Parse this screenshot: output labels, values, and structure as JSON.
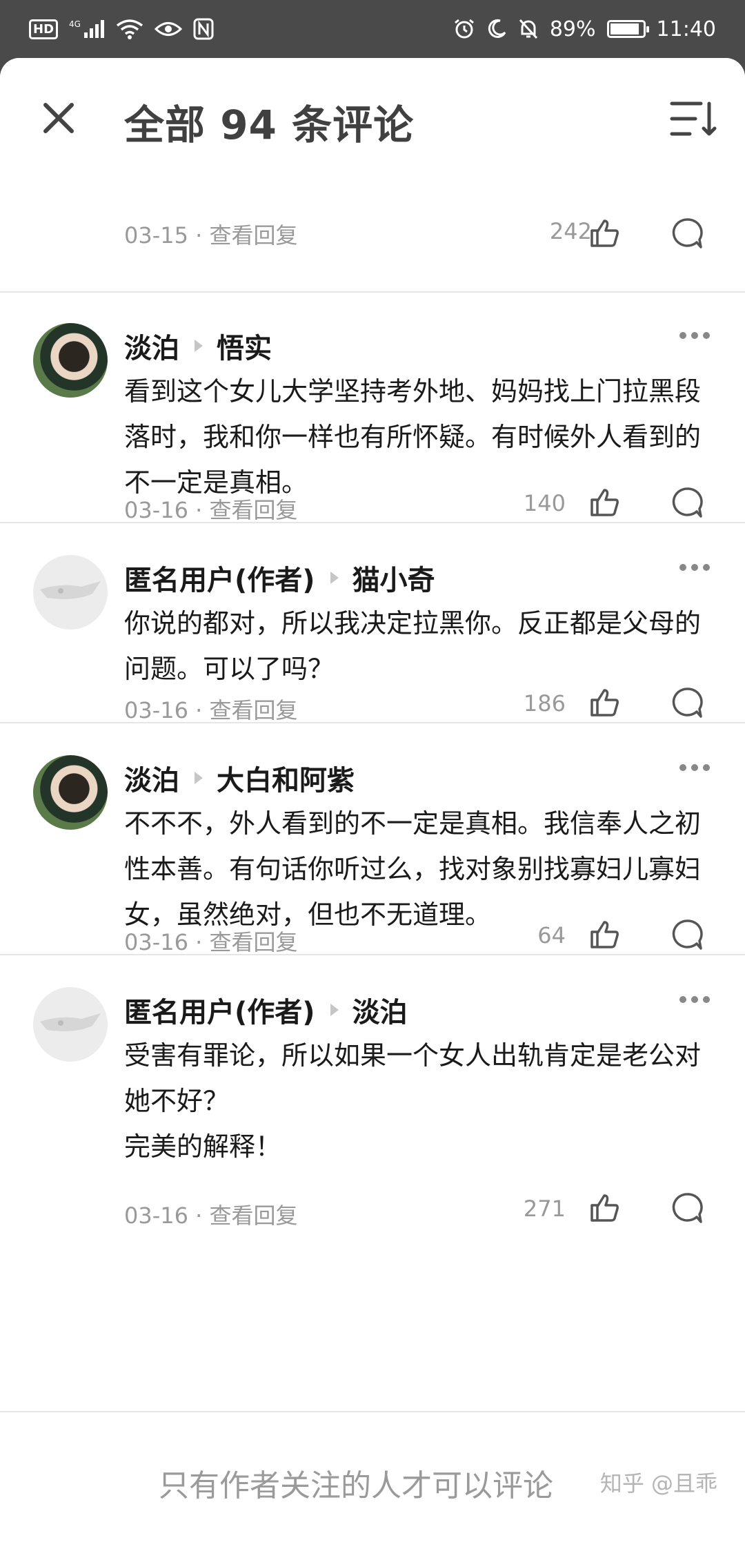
{
  "status_bar": {
    "left_icons": [
      "hd-icon",
      "signal-4g-icon",
      "wifi-icon",
      "eye-icon",
      "nfc-icon"
    ],
    "hd_label": "HD",
    "net_label": "4G",
    "right_icons": [
      "alarm-icon",
      "moon-icon",
      "bell-off-icon",
      "battery-icon"
    ],
    "battery": "89%",
    "battery_level": 0.89,
    "time": "11:40"
  },
  "header": {
    "title": "全部 94 条评论"
  },
  "partial_comment": {
    "meta": "03-15 · 查看回复",
    "like_count": "242"
  },
  "comments": [
    {
      "author": "淡泊",
      "reply_to": "悟实",
      "avatar": "photo",
      "text": "看到这个女儿大学坚持考外地、妈妈找上门拉黑段落时，我和你一样也有所怀疑。有时候外人看到的不一定是真相。",
      "meta": "03-16 · 查看回复",
      "like_count": "140"
    },
    {
      "author": "匿名用户(作者)",
      "reply_to": "猫小奇",
      "avatar": "anon",
      "text": "你说的都对，所以我决定拉黑你。反正都是父母的问题。可以了吗？",
      "meta": "03-16 · 查看回复",
      "like_count": "186"
    },
    {
      "author": "淡泊",
      "reply_to": "大白和阿紫",
      "avatar": "photo",
      "text": "不不不，外人看到的不一定是真相。我信奉人之初性本善。有句话你听过么，找对象别找寡妇儿寡妇女，虽然绝对，但也不无道理。",
      "meta": "03-16 · 查看回复",
      "like_count": "64"
    },
    {
      "author": "匿名用户(作者)",
      "reply_to": "淡泊",
      "avatar": "anon",
      "text_lines": [
        "受害有罪论，所以如果一个女人出轨肯定是老公对她不好？",
        "完美的解释！"
      ],
      "meta": "03-16 · 查看回复",
      "like_count": "271"
    }
  ],
  "footer": {
    "notice": "只有作者关注的人才可以评论",
    "watermark": "知乎 @且乖"
  }
}
